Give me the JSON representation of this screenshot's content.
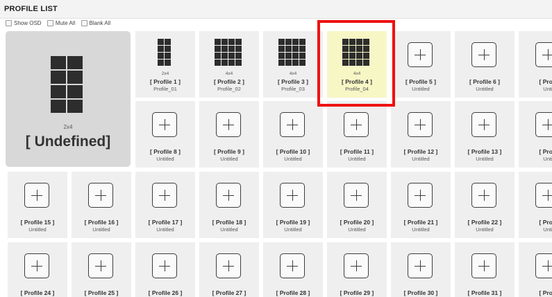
{
  "header": {
    "title": "PROFILE LIST"
  },
  "options": [
    {
      "label": "Show OSD"
    },
    {
      "label": "Mute All"
    },
    {
      "label": "Blank All"
    }
  ],
  "current": {
    "ratio": "2x4",
    "name": "[ Undefined]"
  },
  "tiles": [
    {
      "label": "[ Profile 1 ]",
      "sub": "Profile_01",
      "ratio": "2x4"
    },
    {
      "label": "[ Profile 2 ]",
      "sub": "Profile_02",
      "ratio": "4x4"
    },
    {
      "label": "[ Profile 3 ]",
      "sub": "Profile_03",
      "ratio": "4x4"
    },
    {
      "label": "[ Profile 4 ]",
      "sub": "Profile_04",
      "ratio": "4x4"
    },
    {
      "label": "[ Profile 5 ]",
      "sub": "Untitled"
    },
    {
      "label": "[ Profile 6 ]",
      "sub": "Untitled"
    },
    {
      "label": "[ Profil",
      "sub": "Untit"
    },
    {
      "label": "[ Profile 8 ]",
      "sub": "Untitled"
    },
    {
      "label": "[ Profile 9 ]",
      "sub": "Untitled"
    },
    {
      "label": "[ Profile 10 ]",
      "sub": "Untitled"
    },
    {
      "label": "[ Profile 11 ]",
      "sub": "Untitled"
    },
    {
      "label": "[ Profile 12 ]",
      "sub": "Untitled"
    },
    {
      "label": "[ Profile 13 ]",
      "sub": "Untitled"
    },
    {
      "label": "[ Profil",
      "sub": "Untit"
    },
    {
      "label": "[ Profile 15 ]",
      "sub": "Untitled"
    },
    {
      "label": "[ Profile 16 ]",
      "sub": "Untitled"
    },
    {
      "label": "[ Profile 17 ]",
      "sub": "Untitled"
    },
    {
      "label": "[ Profile 18 ]",
      "sub": "Untitled"
    },
    {
      "label": "[ Profile 19 ]",
      "sub": "Untitled"
    },
    {
      "label": "[ Profile 20 ]",
      "sub": "Untitled"
    },
    {
      "label": "[ Profile 21 ]",
      "sub": "Untitled"
    },
    {
      "label": "[ Profile 22 ]",
      "sub": "Untitled"
    },
    {
      "label": "[ Profil",
      "sub": "Untit"
    },
    {
      "label": "[ Profile 24 ]",
      "sub": "Untitled"
    },
    {
      "label": "[ Profile 25 ]",
      "sub": "Untitled"
    },
    {
      "label": "[ Profile 26 ]",
      "sub": "Untitled"
    },
    {
      "label": "[ Profile 27 ]",
      "sub": "Untitled"
    },
    {
      "label": "[ Profile 28 ]",
      "sub": "Untitled"
    },
    {
      "label": "[ Profile 29 ]",
      "sub": "Untitled"
    },
    {
      "label": "[ Profile 30 ]",
      "sub": "Untitled"
    },
    {
      "label": "[ Profile 31 ]",
      "sub": "Untitled"
    },
    {
      "label": "[ Profil",
      "sub": "Untit"
    }
  ],
  "colors": {
    "tile": "#efefef",
    "selected_tile": "#f7f7c6",
    "highlight_border": "#ee1111"
  }
}
